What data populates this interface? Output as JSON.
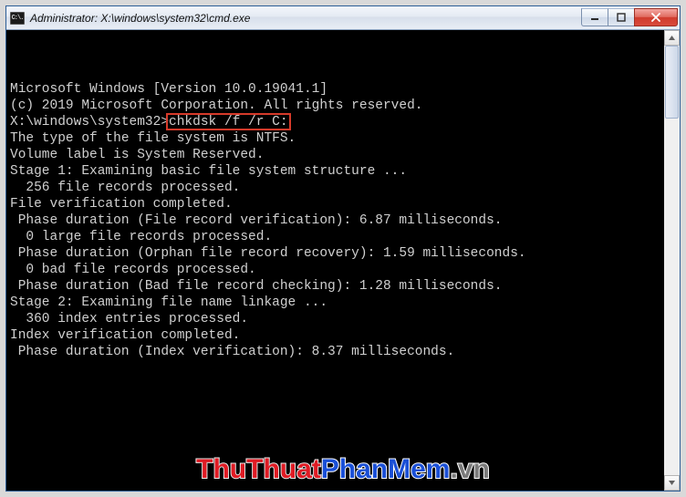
{
  "window": {
    "title": "Administrator: X:\\windows\\system32\\cmd.exe",
    "app_icon_glyph": "C:\\."
  },
  "console": {
    "prompt": "X:\\windows\\system32>",
    "command": "chkdsk /f /r C:",
    "lines": [
      "Microsoft Windows [Version 10.0.19041.1]",
      "(c) 2019 Microsoft Corporation. All rights reserved.",
      "",
      "__PROMPT__",
      "The type of the file system is NTFS.",
      "Volume label is System Reserved.",
      "",
      "Stage 1: Examining basic file system structure ...",
      "",
      "",
      "  256 file records processed.",
      "File verification completed.",
      " Phase duration (File record verification): 6.87 milliseconds.",
      "",
      "",
      "  0 large file records processed.",
      " Phase duration (Orphan file record recovery): 1.59 milliseconds.",
      "",
      "",
      "  0 bad file records processed.",
      " Phase duration (Bad file record checking): 1.28 milliseconds.",
      "",
      "Stage 2: Examining file name linkage ...",
      "",
      "",
      "  360 index entries processed.",
      "Index verification completed.",
      " Phase duration (Index verification): 8.37 milliseconds."
    ]
  },
  "highlight": {
    "target": "chkdsk /f /r C:",
    "color": "#d63a2a"
  },
  "watermark": {
    "part1": "ThuThuat",
    "part2": "PhanMem",
    "part3": ".vn"
  }
}
